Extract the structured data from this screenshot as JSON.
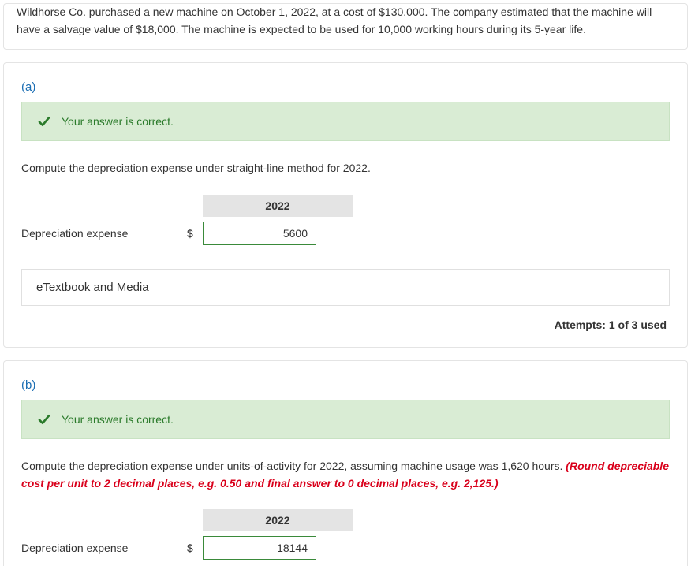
{
  "problem": {
    "text": "Wildhorse Co. purchased a new machine on October 1, 2022, at a cost of $130,000. The company estimated that the machine will have a salvage value of $18,000. The machine is expected to be used for 10,000 working hours during its 5-year life."
  },
  "banner": {
    "correct": "Your answer is correct."
  },
  "partA": {
    "label": "(a)",
    "instruction": "Compute the depreciation expense under straight-line method for 2022.",
    "year": "2022",
    "row_label": "Depreciation expense",
    "currency": "$",
    "value": "5600",
    "media": "eTextbook and Media",
    "attempts": "Attempts: 1 of 3 used"
  },
  "partB": {
    "label": "(b)",
    "instruction_plain": "Compute the depreciation expense under units-of-activity for 2022, assuming machine usage was 1,620 hours. ",
    "instruction_red": "(Round depreciable cost per unit to 2 decimal places, e.g. 0.50 and final answer to 0 decimal places, e.g. 2,125.)",
    "year": "2022",
    "row_label": "Depreciation expense",
    "currency": "$",
    "value": "18144"
  }
}
